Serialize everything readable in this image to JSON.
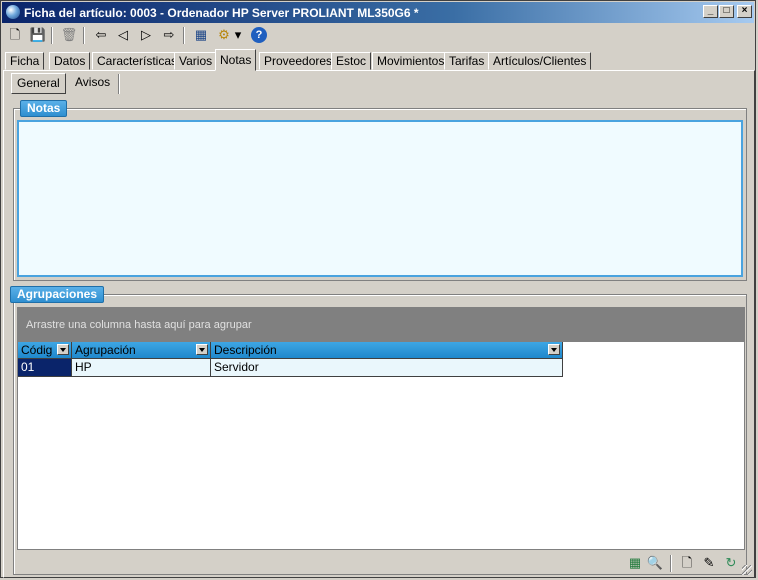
{
  "window": {
    "title": "Ficha del artículo:  0003 - Ordenador HP Server PROLIANT ML350G6 *",
    "controls": {
      "minimize": "_",
      "maximize": "□",
      "close": "×"
    }
  },
  "toolbar": {
    "new_icon": "🗋",
    "save_icon": "💾",
    "delete_icon": "🗑",
    "first_icon": "⇦",
    "prev_icon": "◁",
    "next_icon": "▷",
    "last_icon": "⇨",
    "calc_icon": "▦",
    "tools_icon": "⚙",
    "dropdown_icon": "▾",
    "help_icon": "?"
  },
  "tabs": [
    {
      "label": "Ficha"
    },
    {
      "label": "Datos"
    },
    {
      "label": "Características"
    },
    {
      "label": "Varios"
    },
    {
      "label": "Notas"
    },
    {
      "label": "Proveedores"
    },
    {
      "label": "Estoc"
    },
    {
      "label": "Movimientos"
    },
    {
      "label": "Tarifas"
    },
    {
      "label": "Artículos/Clientes"
    }
  ],
  "active_tab": "Notas",
  "subtabs": [
    {
      "label": "General"
    },
    {
      "label": "Avisos"
    }
  ],
  "notes": {
    "label": "Notas",
    "value": ""
  },
  "groupings": {
    "label": "Agrupaciones",
    "group_hint": "Arrastre una columna hasta aquí para agrupar",
    "columns": [
      "Códig",
      "Agrupación",
      "Descripción"
    ],
    "rows": [
      [
        "01",
        "HP",
        "Servidor"
      ]
    ]
  },
  "bottom_icons": {
    "excel_icon": "▦",
    "preview_icon": "🔍",
    "new_icon": "🗋",
    "edit_icon": "✎",
    "refresh_icon": "↻"
  }
}
